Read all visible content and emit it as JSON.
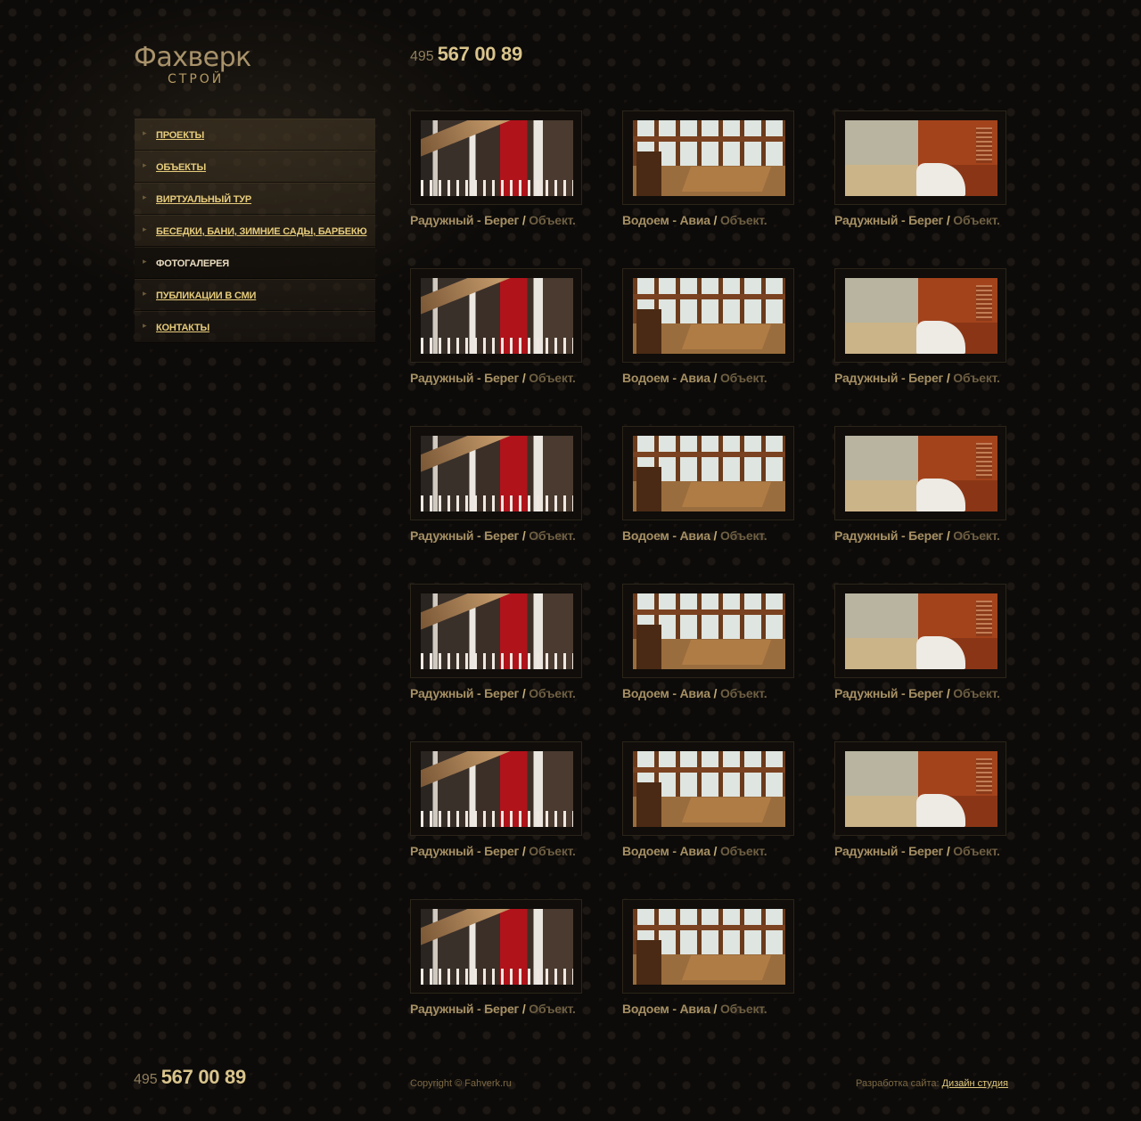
{
  "logo": {
    "title": "Фахверк",
    "subtitle": "СТРОЙ"
  },
  "phone": {
    "code": "495",
    "number": "567 00 89"
  },
  "menu": {
    "items": [
      {
        "label": "ПРОЕКТЫ",
        "active": false
      },
      {
        "label": "ОБЪЕКТЫ",
        "active": false
      },
      {
        "label": "ВИРТУАЛЬНЫЙ ТУР",
        "active": false
      },
      {
        "label": "БЕСЕДКИ, БАНИ, ЗИМНИЕ САДЫ, БАРБЕКЮ",
        "active": false
      },
      {
        "label": "ФОТОГАЛЕРЕЯ",
        "active": true
      },
      {
        "label": "ПУБЛИКАЦИИ В СМИ",
        "active": false
      },
      {
        "label": "КОНТАКТЫ",
        "active": false
      }
    ],
    "arrow_icon": "triangle-right-icon"
  },
  "gallery": {
    "separator": "/",
    "items": [
      {
        "name": "Радужный - Берег",
        "kind": "Объект.",
        "photo": "porch-red-door"
      },
      {
        "name": "Водоем - Авиа",
        "kind": "Объект.",
        "photo": "window-room"
      },
      {
        "name": "Радужный - Берег",
        "kind": "Объект.",
        "photo": "bathroom"
      },
      {
        "name": "Радужный - Берег",
        "kind": "Объект.",
        "photo": "porch-red-door"
      },
      {
        "name": "Водоем - Авиа",
        "kind": "Объект.",
        "photo": "window-room"
      },
      {
        "name": "Радужный - Берег",
        "kind": "Объект.",
        "photo": "bathroom"
      },
      {
        "name": "Радужный - Берег",
        "kind": "Объект.",
        "photo": "porch-red-door"
      },
      {
        "name": "Водоем - Авиа",
        "kind": "Объект.",
        "photo": "window-room"
      },
      {
        "name": "Радужный - Берег",
        "kind": "Объект.",
        "photo": "bathroom"
      },
      {
        "name": "Радужный - Берег",
        "kind": "Объект.",
        "photo": "porch-red-door"
      },
      {
        "name": "Водоем - Авиа",
        "kind": "Объект.",
        "photo": "window-room"
      },
      {
        "name": "Радужный - Берег",
        "kind": "Объект.",
        "photo": "bathroom"
      },
      {
        "name": "Радужный - Берег",
        "kind": "Объект.",
        "photo": "porch-red-door"
      },
      {
        "name": "Водоем - Авиа",
        "kind": "Объект.",
        "photo": "window-room"
      },
      {
        "name": "Радужный - Берег",
        "kind": "Объект.",
        "photo": "bathroom"
      },
      {
        "name": "Радужный - Берег",
        "kind": "Объект.",
        "photo": "porch-red-door"
      },
      {
        "name": "Водоем - Авиа",
        "kind": "Объект.",
        "photo": "window-room"
      }
    ]
  },
  "footer": {
    "copyright": "Copyright © Fahverk.ru",
    "dev_label": "Разработка сайта:",
    "dev_link": "Дизайн студия"
  },
  "colors": {
    "background": "#0d0b09",
    "menu_link": "#e6cc7c",
    "caption_name": "#a69064",
    "caption_kind": "#6e5f43"
  }
}
